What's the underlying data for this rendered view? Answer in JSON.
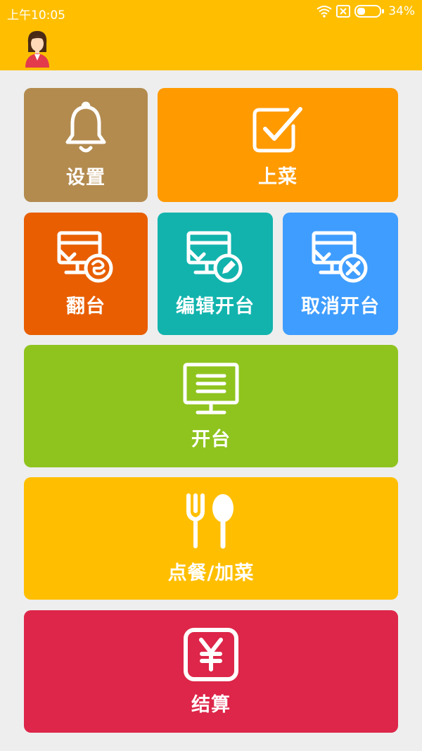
{
  "status_bar": {
    "time": "上午10:05",
    "battery": "34%"
  },
  "colors": {
    "header": "#ffbf00",
    "settings": "#b38b4f",
    "serve": "#ff9a00",
    "flip": "#e85e00",
    "edit": "#12b3ad",
    "cancel": "#3f9dff",
    "open": "#8fc41e",
    "order": "#ffbf00",
    "pay": "#dd2649"
  },
  "tiles": {
    "settings": {
      "label": "设置",
      "icon": "bell-icon"
    },
    "serve": {
      "label": "上菜",
      "icon": "checkbox-icon"
    },
    "flip": {
      "label": "翻台",
      "icon": "table-flip-icon"
    },
    "edit_open": {
      "label": "编辑开台",
      "icon": "table-edit-icon"
    },
    "cancel_open": {
      "label": "取消开台",
      "icon": "table-cancel-icon"
    },
    "open": {
      "label": "开台",
      "icon": "monitor-icon"
    },
    "order": {
      "label": "点餐/加菜",
      "icon": "fork-spoon-icon"
    },
    "pay": {
      "label": "结算",
      "icon": "yen-icon"
    }
  }
}
